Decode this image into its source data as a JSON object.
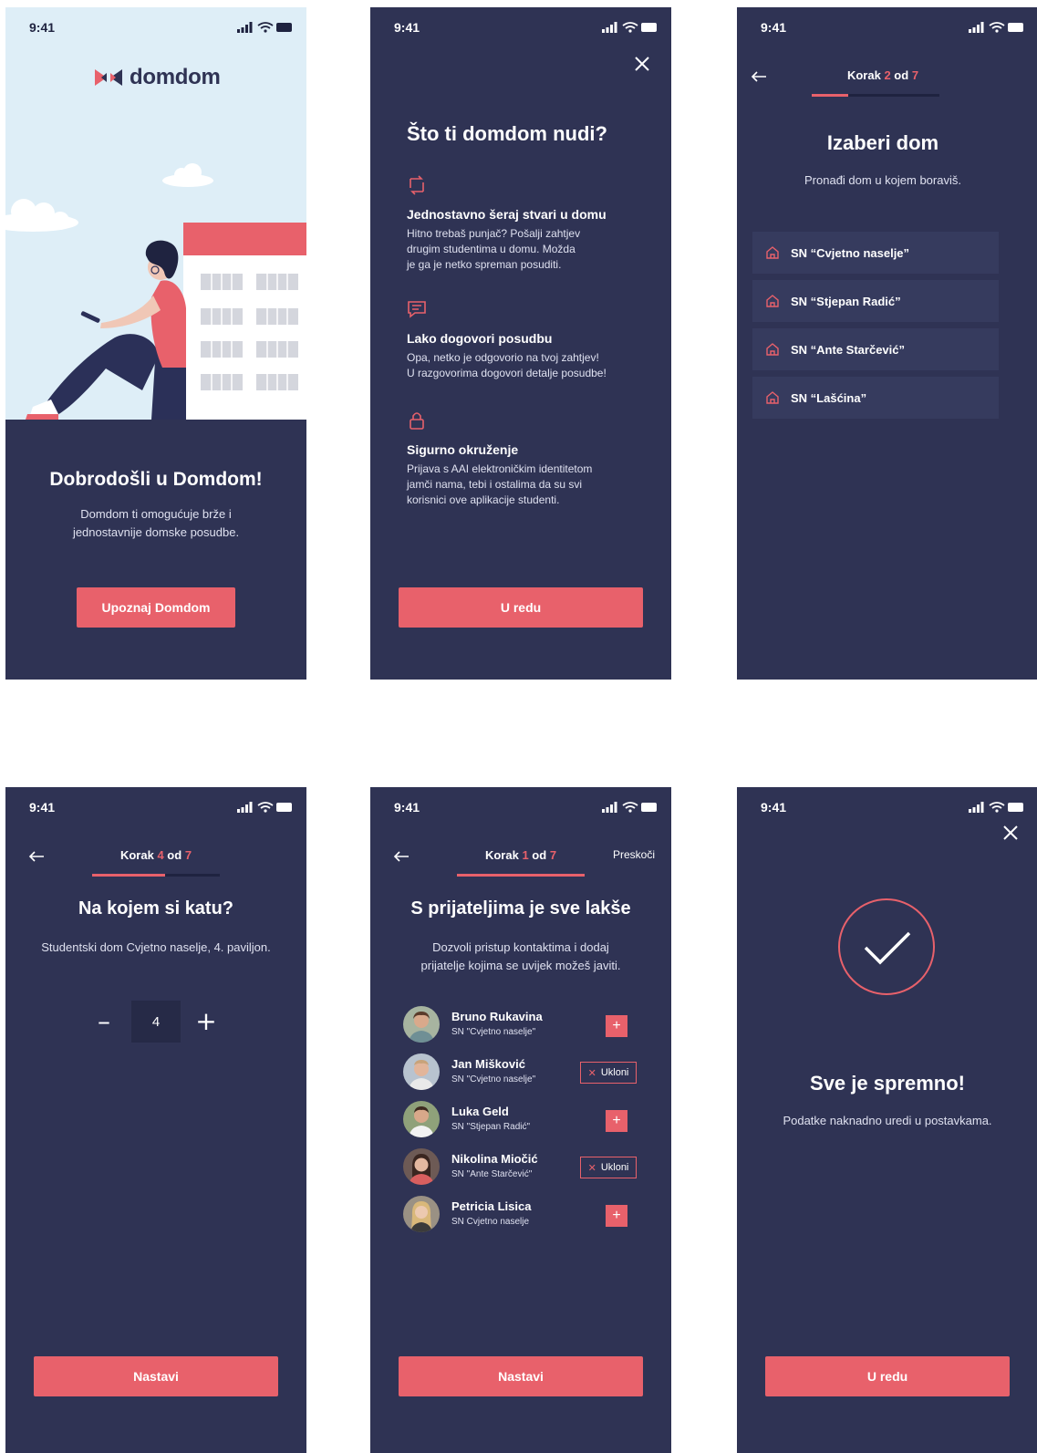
{
  "status_bar": {
    "time": "9:41"
  },
  "colors": {
    "background": "#2f3354",
    "accent": "#e8616b",
    "sky": "#deeef7",
    "card": "#363b5e"
  },
  "welcome": {
    "logo_text": "domdom",
    "title": "Dobrodošli u Domdom!",
    "subtitle_line1": "Domdom ti omogućuje brže i",
    "subtitle_line2": "jednostavnije domske posudbe.",
    "button": "Upoznaj Domdom"
  },
  "features": {
    "title": "Što ti domdom nudi?",
    "items": [
      {
        "icon": "swap-icon",
        "heading": "Jednostavno šeraj stvari u domu",
        "lines": [
          "Hitno trebaš punjač? Pošalji zahtjev",
          "drugim studentima u domu. Možda",
          "je ga je netko spreman posuditi."
        ]
      },
      {
        "icon": "chat-icon",
        "heading": "Lako dogovori posudbu",
        "lines": [
          "Opa, netko je odgovorio na tvoj zahtjev!",
          "U razgovorima dogovori detalje posudbe!"
        ]
      },
      {
        "icon": "lock-icon",
        "heading": "Sigurno okruženje",
        "lines": [
          "Prijava s AAI elektroničkim identitetom",
          "jamči nama, tebi i ostalima da su svi",
          "korisnici ove aplikacije studenti."
        ]
      }
    ],
    "button": "U redu"
  },
  "choose_dorm": {
    "step_prefix": "Korak",
    "step_current": "2",
    "step_of": "od",
    "step_total": "7",
    "progress": 0.286,
    "title": "Izaberi dom",
    "subtitle": "Pronađi dom u kojem boraviš.",
    "dorms": [
      "SN  “Cvjetno naselje”",
      "SN  “Stjepan Radić”",
      "SN “Ante Starčević”",
      "SN “Lašćina”"
    ]
  },
  "floor": {
    "step_prefix": "Korak",
    "step_current": "4",
    "step_of": "od",
    "step_total": "7",
    "progress": 0.571,
    "title": "Na kojem si katu?",
    "subtitle": "Studentski dom Cvjetno naselje, 4. paviljon.",
    "value": "4",
    "minus": "–",
    "plus": "+",
    "button": "Nastavi"
  },
  "friends": {
    "step_prefix": "Korak",
    "step_current": "1",
    "step_of": "od",
    "step_total": "7",
    "progress": 1.0,
    "skip": "Preskoči",
    "title": "S prijateljima je sve lakše",
    "subtitle_line1": "Dozvoli pristup kontaktima i dodaj",
    "subtitle_line2": "prijatelje kojima se uvijek možeš javiti.",
    "remove_label": "Ukloni",
    "add_label": "+",
    "list": [
      {
        "name": "Bruno Rukavina",
        "dorm": "SN \"Cvjetno naselje\"",
        "state": "add"
      },
      {
        "name": "Jan Mišković",
        "dorm": "SN \"Cvjetno naselje\"",
        "state": "remove"
      },
      {
        "name": "Luka Geld",
        "dorm": "SN \"Stjepan Radić\"",
        "state": "add"
      },
      {
        "name": "Nikolina Miočić",
        "dorm": "SN \"Ante Starčević\"",
        "state": "remove"
      },
      {
        "name": "Petricia Lisica",
        "dorm": "SN Cvjetno naselje",
        "state": "add"
      }
    ],
    "button": "Nastavi"
  },
  "done": {
    "title": "Sve je spremno!",
    "subtitle": "Podatke naknadno uredi u postavkama.",
    "button": "U redu"
  }
}
